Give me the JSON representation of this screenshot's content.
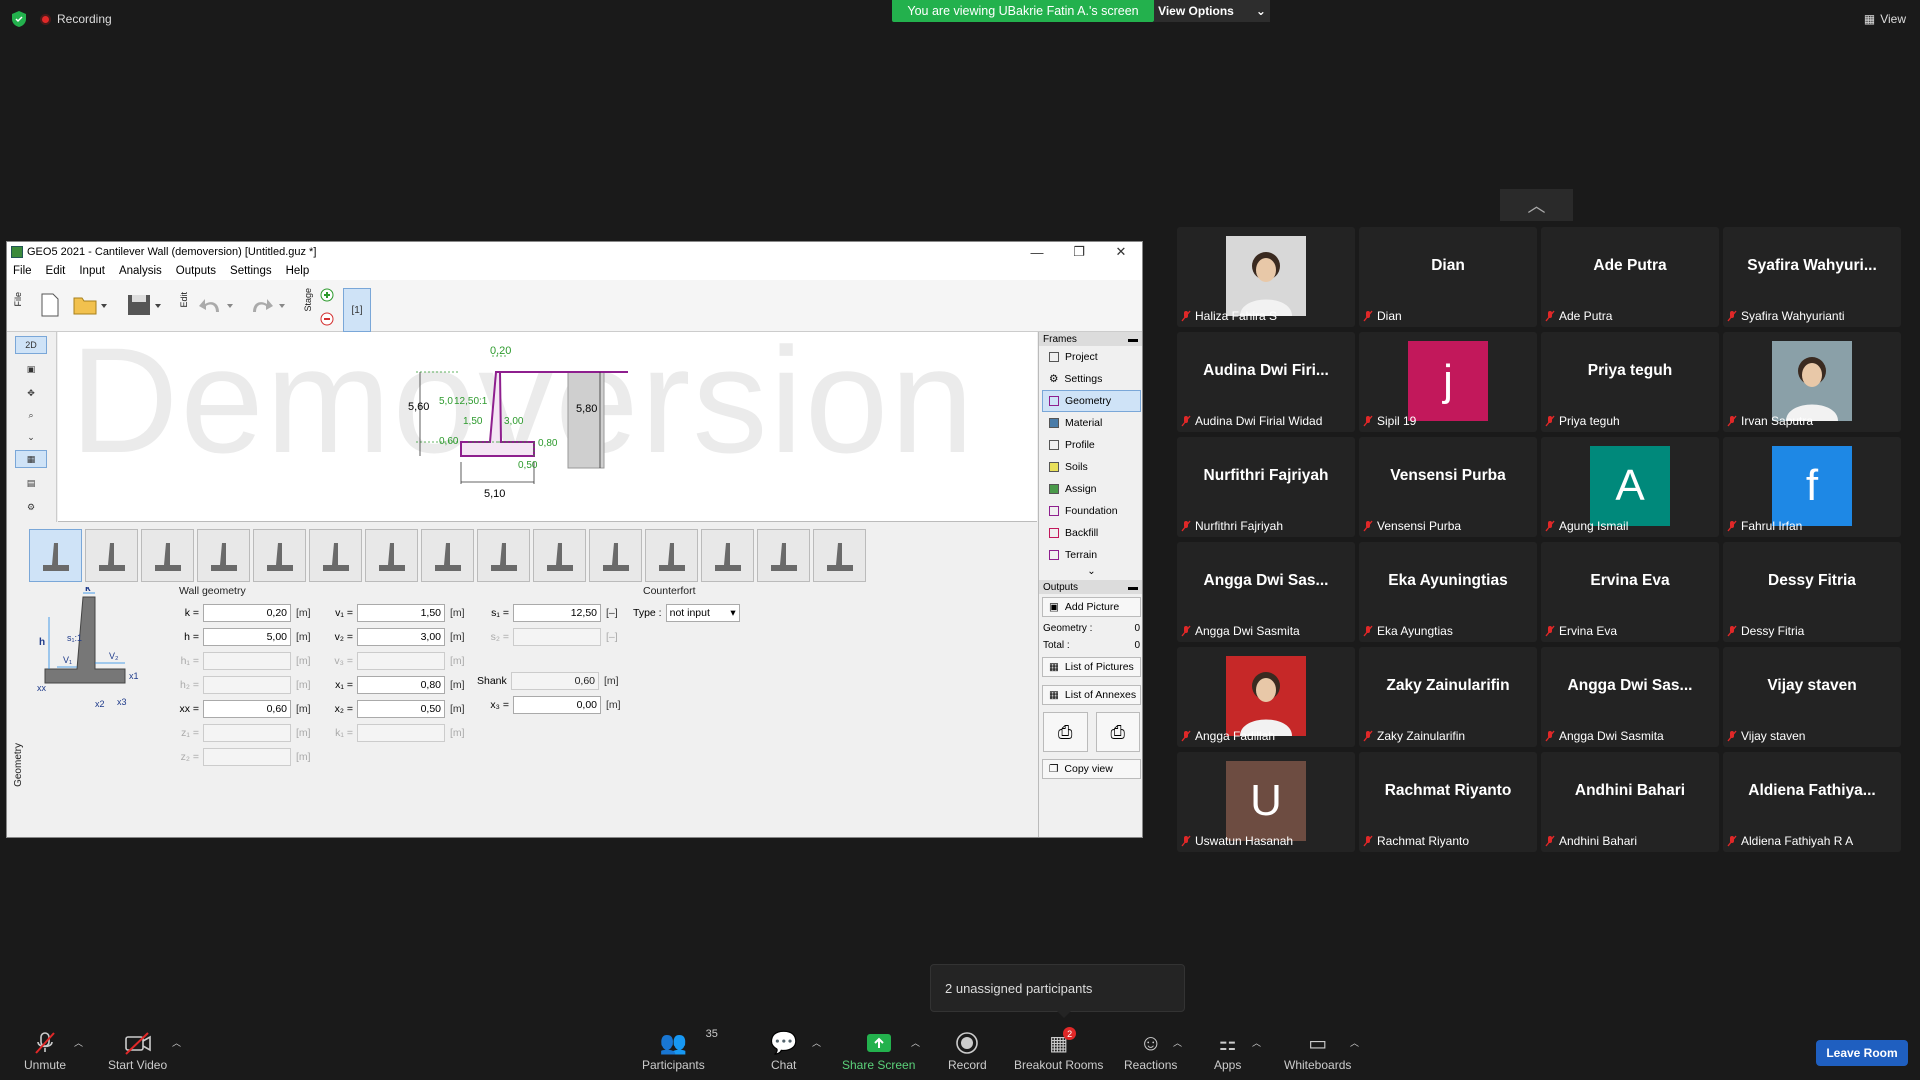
{
  "top": {
    "recording_label": "Recording",
    "viewing_banner": "You are viewing UBakrie Fatin A.'s screen",
    "view_options": "View Options",
    "view_label": "View"
  },
  "geo": {
    "title": "GEO5 2021 - Cantilever Wall (demoversion) [Untitled.guz *]",
    "menu": [
      "File",
      "Edit",
      "Input",
      "Analysis",
      "Outputs",
      "Settings",
      "Help"
    ],
    "toolbar": {
      "file_tab": "File",
      "edit_tab": "Edit",
      "stage_tab": "Stage",
      "stage_value": "[1]"
    },
    "left_tools": {
      "view_2d": "2D"
    },
    "watermark": "Demoversion",
    "drawing_labels": {
      "top_width": "0,20",
      "left_height": "5,60",
      "left_inner": "5,0",
      "slope": "12,50:1",
      "v1": "1,50",
      "v2": "3,00",
      "toe": "0,60",
      "heel": "0,80",
      "base_thick": "0,50",
      "base_width": "5,10",
      "right_height": "5,80"
    },
    "frames": {
      "header": "Frames",
      "items": [
        "Project",
        "Settings",
        "Geometry",
        "Material",
        "Profile",
        "Soils",
        "Assign",
        "Foundation",
        "Backfill",
        "Terrain"
      ],
      "outputs_header": "Outputs",
      "add_picture": "Add Picture",
      "geometry_label": "Geometry :",
      "geometry_count": "0",
      "total_label": "Total :",
      "total_count": "0",
      "list_of_pictures": "List of Pictures",
      "list_of_annexes": "List of Annexes",
      "copy_view": "Copy view"
    },
    "geometry_panel": {
      "side_label": "Geometry",
      "wall_geometry": "Wall geometry",
      "counterfort": "Counterfort",
      "type_label": "Type :",
      "type_value": "not input",
      "shank_label": "Shank",
      "shank_value": "0,60",
      "diagram_labels": {
        "k": "k",
        "h": "h",
        "s1": "s₁:1",
        "v1": "V₁",
        "v2": "V₂",
        "x1": "x1",
        "xx": "xx",
        "x2": "x2",
        "x3": "x3"
      },
      "col1": [
        {
          "label": "k =",
          "value": "0,20",
          "unit": "[m]",
          "enabled": true
        },
        {
          "label": "h =",
          "value": "5,00",
          "unit": "[m]",
          "enabled": true
        },
        {
          "label": "h₁ =",
          "value": "",
          "unit": "[m]",
          "enabled": false
        },
        {
          "label": "h₂ =",
          "value": "",
          "unit": "[m]",
          "enabled": false
        },
        {
          "label": "xx =",
          "value": "0,60",
          "unit": "[m]",
          "enabled": true
        },
        {
          "label": "z₁ =",
          "value": "",
          "unit": "[m]",
          "enabled": false
        },
        {
          "label": "z₂ =",
          "value": "",
          "unit": "[m]",
          "enabled": false
        }
      ],
      "col2": [
        {
          "label": "v₁ =",
          "value": "1,50",
          "unit": "[m]",
          "enabled": true
        },
        {
          "label": "v₂ =",
          "value": "3,00",
          "unit": "[m]",
          "enabled": true
        },
        {
          "label": "v₃ =",
          "value": "",
          "unit": "[m]",
          "enabled": false
        },
        {
          "label": "x₁ =",
          "value": "0,80",
          "unit": "[m]",
          "enabled": true
        },
        {
          "label": "x₂ =",
          "value": "0,50",
          "unit": "[m]",
          "enabled": true
        },
        {
          "label": "k₁ =",
          "value": "",
          "unit": "[m]",
          "enabled": false
        }
      ],
      "col3": [
        {
          "label": "s₁ =",
          "value": "12,50",
          "unit": "[–]",
          "enabled": true
        },
        {
          "label": "s₂ =",
          "value": "",
          "unit": "[–]",
          "enabled": false
        }
      ],
      "x3": {
        "label": "x₃ =",
        "value": "0,00",
        "unit": "[m]"
      },
      "shank_unit": "[m]"
    }
  },
  "participants": [
    {
      "name": "Haliza Fahira S",
      "display": "",
      "kind": "photo",
      "color": "#d8d8d8"
    },
    {
      "name": "Dian",
      "display": "Dian",
      "kind": "name"
    },
    {
      "name": "Ade Putra",
      "display": "Ade Putra",
      "kind": "name"
    },
    {
      "name": "Syafira Wahyurianti",
      "display": "Syafira  Wahyuri...",
      "kind": "name"
    },
    {
      "name": "Audina Dwi Firial Widad",
      "display": "Audina Dwi Firi...",
      "kind": "name"
    },
    {
      "name": "Sipil 19",
      "display": "j",
      "kind": "letter",
      "color": "#c2185b"
    },
    {
      "name": "Priya teguh",
      "display": "Priya teguh",
      "kind": "name"
    },
    {
      "name": "Irvan Saputra",
      "display": "",
      "kind": "photo",
      "color": "#8aa0a8"
    },
    {
      "name": "Nurfithri Fajriyah",
      "display": "Nurfithri Fajriyah",
      "kind": "name"
    },
    {
      "name": "Vensensi Purba",
      "display": "Vensensi Purba",
      "kind": "name"
    },
    {
      "name": "Agung Ismail",
      "display": "A",
      "kind": "letter",
      "color": "#00897b"
    },
    {
      "name": "Fahrul Irfan",
      "display": "f",
      "kind": "letter",
      "color": "#1e88e5"
    },
    {
      "name": "Angga Dwi Sasmita",
      "display": "Angga Dwi Sas...",
      "kind": "name"
    },
    {
      "name": "Eka Ayungtias",
      "display": "Eka Ayuningtias",
      "kind": "name"
    },
    {
      "name": "Ervina Eva",
      "display": "Ervina Eva",
      "kind": "name"
    },
    {
      "name": "Dessy Fitria",
      "display": "Dessy Fitria",
      "kind": "name"
    },
    {
      "name": "Angga Fadillah",
      "display": "",
      "kind": "photo",
      "color": "#c62828"
    },
    {
      "name": "Zaky Zainularifin",
      "display": "Zaky Zainularifin",
      "kind": "name"
    },
    {
      "name": "Angga Dwi Sasmita",
      "display": "Angga  Dwi  Sas...",
      "kind": "name"
    },
    {
      "name": "Vijay staven",
      "display": "Vijay staven",
      "kind": "name"
    },
    {
      "name": "Uswatun Hasanah",
      "display": "U",
      "kind": "letter",
      "color": "#6d4c41"
    },
    {
      "name": "Rachmat Riyanto",
      "display": "Rachmat Riyanto",
      "kind": "name"
    },
    {
      "name": "Andhini Bahari",
      "display": "Andhini Bahari",
      "kind": "name"
    },
    {
      "name": "Aldiena Fathiyah R A",
      "display": "Aldiena  Fathiya...",
      "kind": "name"
    }
  ],
  "tooltip": "2 unassigned participants",
  "bottom_bar": {
    "unmute": "Unmute",
    "start_video": "Start Video",
    "participants": "Participants",
    "participants_count": "35",
    "chat": "Chat",
    "share_screen": "Share Screen",
    "record": "Record",
    "breakout_rooms": "Breakout Rooms",
    "breakout_badge": "2",
    "reactions": "Reactions",
    "apps": "Apps",
    "whiteboards": "Whiteboards",
    "leave_room": "Leave Room"
  },
  "colors": {
    "share_green": "#23b14d",
    "leave_blue": "#1f5fc0",
    "muted_red": "#e02828",
    "wall_purple": "#8e1f8e",
    "dim_green": "#2c9a2c"
  }
}
